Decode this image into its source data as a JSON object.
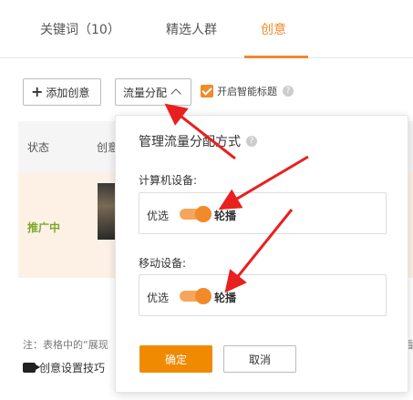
{
  "tabs": [
    {
      "label": "关键词（10）"
    },
    {
      "label": "精选人群"
    },
    {
      "label": "创意"
    }
  ],
  "toolbar": {
    "add_label": "添加创意",
    "flow_label": "流量分配",
    "smart_label": "开启智能标题"
  },
  "table": {
    "headers": [
      "状态",
      "创意"
    ],
    "row": {
      "status": "推广中"
    }
  },
  "popover": {
    "title": "管理流量分配方式",
    "pc_label": "计算机设备:",
    "pc_left": "优选",
    "pc_right": "轮播",
    "pc_mode": "轮播",
    "mobile_label": "移动设备:",
    "mobile_left": "优选",
    "mobile_right": "轮播",
    "mobile_mode": "轮播",
    "ok_label": "确定",
    "cancel_label": "取消"
  },
  "footer": {
    "note": "注：表格中的“展现",
    "note_right": "看",
    "tips_label": "创意设置技巧"
  },
  "colors": {
    "accent": "#f08a2a",
    "status_green": "#7aa829",
    "annotation_red": "#e8201e"
  },
  "icons": [
    "plus-icon",
    "chevron-up-icon",
    "checkbox-checked-icon",
    "help-icon",
    "video-icon",
    "red-arrow-annotation"
  ]
}
